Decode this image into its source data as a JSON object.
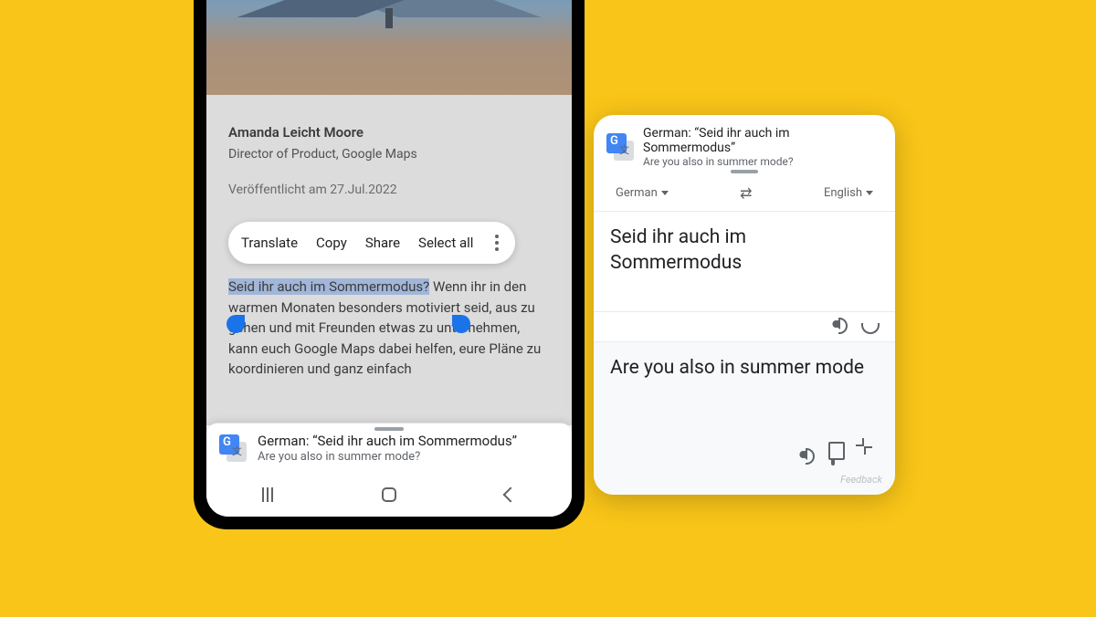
{
  "article": {
    "author_name": "Amanda Leicht Moore",
    "author_title": "Director of Product, Google Maps",
    "published": "Veröffentlicht am 27.Jul.2022",
    "selected_text": "Seid ihr auch im Sommermodus?",
    "body_rest": " Wenn ihr in den warmen Monaten besonders motiviert seid, aus zu gehen und mit Freunden etwas zu unternehmen, kann euch Google Maps dabei helfen, eure Pläne zu koordinieren und ganz einfach"
  },
  "selection_toolbar": {
    "translate": "Translate",
    "copy": "Copy",
    "share": "Share",
    "select_all": "Select all"
  },
  "bottom_translate": {
    "title": "German: “Seid ihr auch im Sommermodus”",
    "subtitle": "Are you also in summer mode?"
  },
  "panel": {
    "header_title": "German: “Seid ihr auch im Sommermodus”",
    "header_sub": "Are you also in summer mode?",
    "src_lang": "German",
    "dst_lang": "English",
    "src_text": "Seid ihr auch im Sommermodus",
    "dst_text": "Are you also in summer mode",
    "feedback": "Feedback"
  }
}
